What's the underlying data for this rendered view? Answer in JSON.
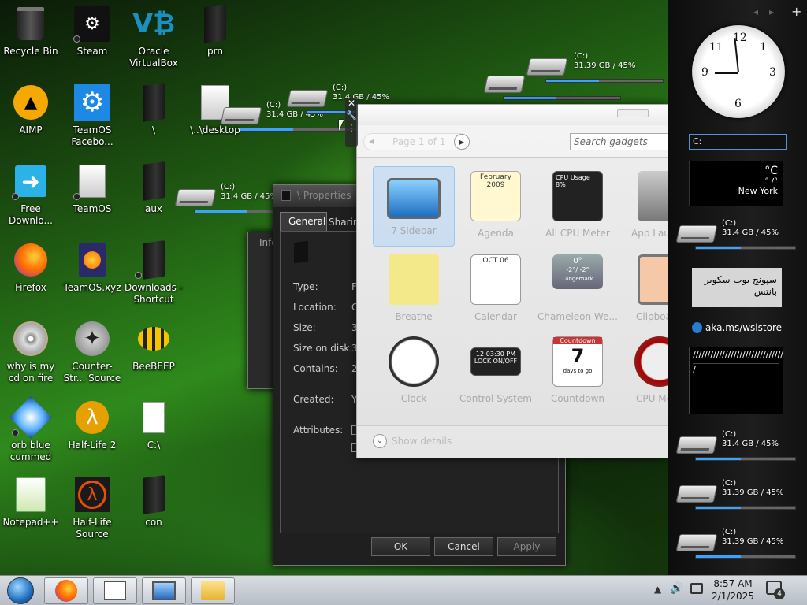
{
  "desktop": {
    "icons": [
      {
        "label": "Recycle Bin"
      },
      {
        "label": "Steam"
      },
      {
        "label": "Oracle VirtualBox"
      },
      {
        "label": "prn"
      },
      {
        "label": "AIMP"
      },
      {
        "label": "TeamOS Facebo..."
      },
      {
        "label": "\\"
      },
      {
        "label": "\\..\\desktop"
      },
      {
        "label": "Free Downlo..."
      },
      {
        "label": "TeamOS"
      },
      {
        "label": "aux"
      },
      {
        "label": "Firefox"
      },
      {
        "label": "TeamOS.xyz"
      },
      {
        "label": "Downloads - Shortcut"
      },
      {
        "label": "why is my cd on fire"
      },
      {
        "label": "Counter-Str... Source"
      },
      {
        "label": "BeeBEEP"
      },
      {
        "label": "orb blue cummed"
      },
      {
        "label": "Half-Life 2"
      },
      {
        "label": "C:\\"
      },
      {
        "label": "Notepad++"
      },
      {
        "label": "Half-Life Source"
      },
      {
        "label": "con"
      }
    ],
    "drives": [
      {
        "name": "(C:)",
        "info": "31.4 GB / 45%",
        "used": 0.45
      },
      {
        "name": "(C:)",
        "info": "31.4 GB / 45%",
        "used": 0.45
      },
      {
        "name": "(C:)",
        "info": "31.39 GB / 45%",
        "used": 0.45
      },
      {
        "name": "(C:)",
        "info": "31.4 GB / 45%",
        "used": 0.45
      },
      {
        "name": "(C:)",
        "info": "31.4 GB / 45%",
        "used": 0.45
      }
    ]
  },
  "properties": {
    "title": "\\ Properties",
    "tabs": [
      "General",
      "Sharing"
    ],
    "fields": [
      "Type:",
      "Location:",
      "Size:",
      "Size on disk:",
      "Contains:",
      "Created:",
      "Attributes:"
    ],
    "partial_values": [
      "F",
      "C",
      "3",
      "3",
      "2",
      "Y"
    ],
    "ok": "OK",
    "cancel": "Cancel",
    "apply": "Apply"
  },
  "behind_window": {
    "title": "Info"
  },
  "gallery": {
    "page_text": "Page 1 of 1",
    "search_placeholder": "Search gadgets",
    "show_details": "Show details",
    "gadgets": [
      {
        "name": "7 Sidebar"
      },
      {
        "name": "Agenda"
      },
      {
        "name": "All CPU Meter"
      },
      {
        "name": "App Launcher"
      },
      {
        "name": "Breathe"
      },
      {
        "name": "Calendar"
      },
      {
        "name": "Chameleon We..."
      },
      {
        "name": "Clipboard"
      },
      {
        "name": "Clock"
      },
      {
        "name": "Control System"
      },
      {
        "name": "Countdown"
      },
      {
        "name": "CPU Meter"
      }
    ],
    "agenda_header": "February 2009",
    "cpu_title": "CPU Usage",
    "cpu_pct": "8%",
    "calendar_month": "OCT 06",
    "weather_temp": "0°",
    "weather_range": "-2°/ -2°",
    "weather_brand": "Langemark",
    "control_time": "12:03:30 PM",
    "control_lock": "LOCK ON/OFF",
    "countdown_title": "Countdown",
    "countdown_days": "7",
    "countdown_sub": "days to go"
  },
  "sidebar": {
    "nav_prev": "◂",
    "nav_next": "▸",
    "nav_add": "+",
    "search_text": "C:",
    "weather_temp": "°C",
    "weather_sub": "° /°",
    "weather_city": "New York",
    "note_text": "سپونج بوب سكوير بانتس",
    "link_text": "aka.ms/wslstore",
    "slash_text": "/////////////////////////////////////////////////////////////////////////",
    "slash_last": "/",
    "drive_labels": []
  },
  "taskbar": {
    "time": "8:57 AM",
    "date": "2/1/2025",
    "notif_count": "4"
  },
  "colors": {
    "accent": "#3aa3ff",
    "green": "#2f8a1c"
  }
}
